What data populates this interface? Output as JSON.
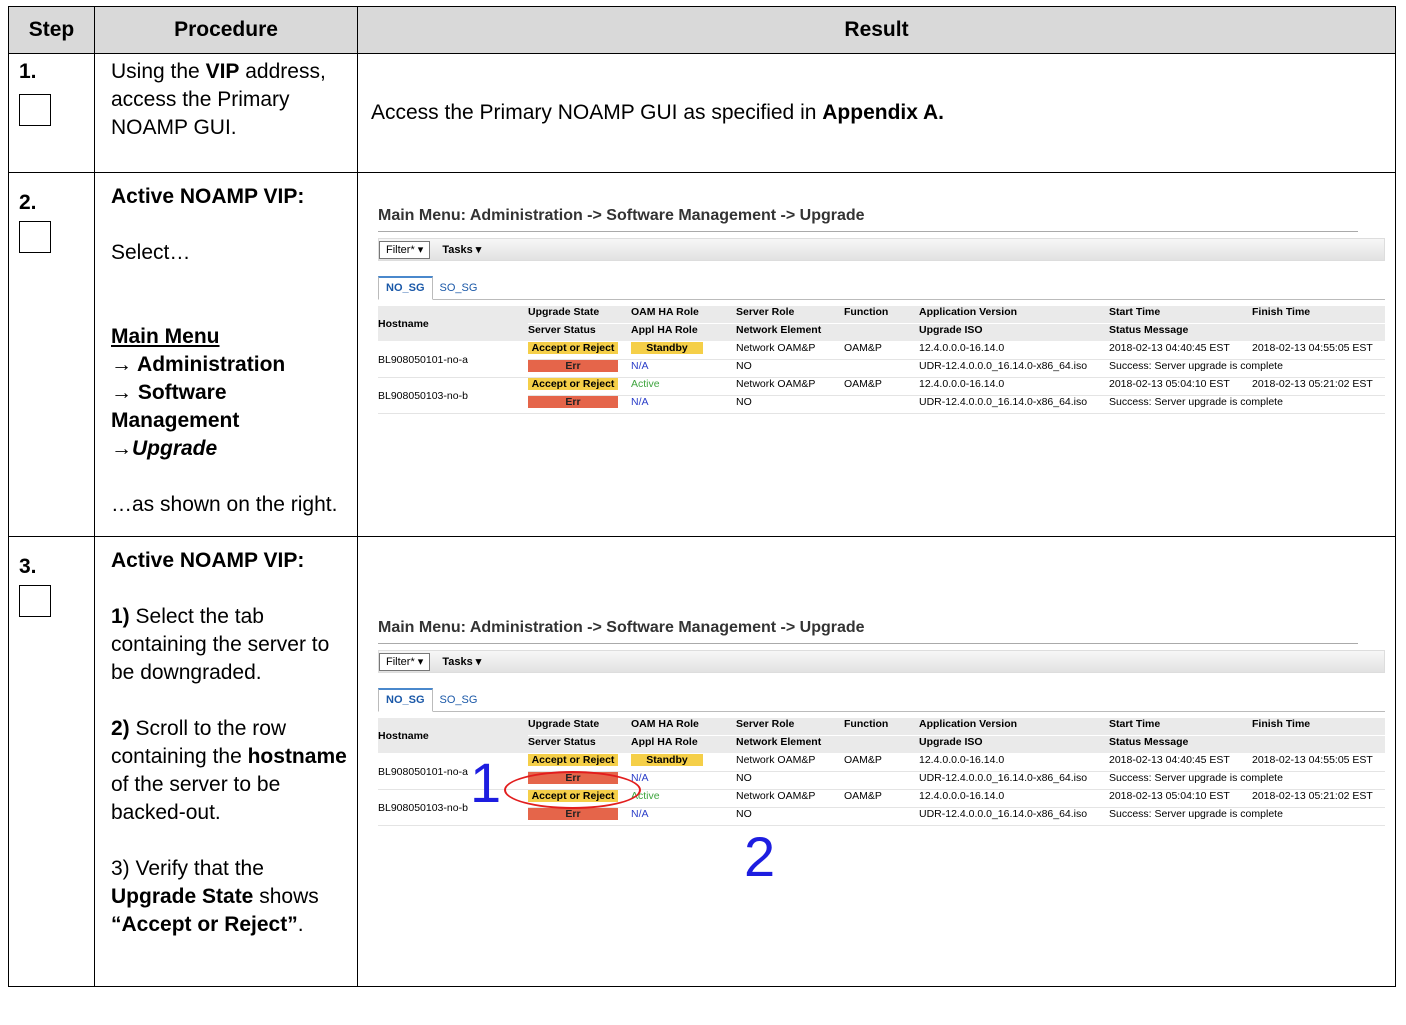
{
  "headers": {
    "step": "Step",
    "procedure": "Procedure",
    "result": "Result"
  },
  "step1": {
    "num": "1.",
    "proc_pre": "Using the ",
    "proc_bold": "VIP",
    "proc_post": " address, access the Primary NOAMP GUI.",
    "result_pre": "Access the Primary NOAMP GUI as specified in ",
    "result_bold": "Appendix A."
  },
  "step2": {
    "num": "2.",
    "heading": "Active NOAMP VIP:",
    "select": "Select…",
    "menu_main": "Main Menu",
    "menu_admin": "→ Administration",
    "menu_sw": "→ Software Management",
    "menu_upgrade": "→Upgrade",
    "shown": "…as shown on the right."
  },
  "step3": {
    "num": "3.",
    "heading": "Active NOAMP VIP:",
    "s1_num": "1)",
    "s1_text": " Select the tab containing the server to be downgraded.",
    "s2_num": "2)",
    "s2_text_a": " Scroll to the row containing the ",
    "s2_bold": "hostname",
    "s2_text_b": " of the server to be backed-out.",
    "s3_text": "3) Verify that the ",
    "s3_bold1": "Upgrade State",
    "s3_text2": " shows ",
    "s3_bold2": "“Accept or Reject”",
    "s3_end": ".",
    "annotation1": "1",
    "annotation2": "2"
  },
  "screenshot": {
    "title": "Main Menu: Administration -> Software Management -> Upgrade",
    "filter": "Filter*",
    "tasks": "Tasks",
    "tabs": [
      "NO_SG",
      "SO_SG"
    ],
    "columns1": [
      "Hostname",
      "Upgrade State",
      "OAM HA Role",
      "Server Role",
      "Function",
      "Application Version",
      "Start Time",
      "Finish Time"
    ],
    "columns2": [
      "Server Status",
      "Appl HA Role",
      "Network Element",
      "Upgrade ISO",
      "Status Message"
    ],
    "rows": [
      {
        "hostname": "BL908050101-no-a",
        "upgrade_state": "Accept or Reject",
        "oam_ha_role": "Standby",
        "server_role": "Network OAM&P",
        "function": "OAM&P",
        "app_version": "12.4.0.0.0-16.14.0",
        "start_time": "2018-02-13 04:40:45 EST",
        "finish_time": "2018-02-13 04:55:05 EST",
        "server_status": "Err",
        "appl_ha_role": "N/A",
        "network_element": "NO",
        "upgrade_iso": "UDR-12.4.0.0.0_16.14.0-x86_64.iso",
        "status_message": "Success: Server upgrade is complete"
      },
      {
        "hostname": "BL908050103-no-b",
        "upgrade_state": "Accept or Reject",
        "oam_ha_role": "Active",
        "server_role": "Network OAM&P",
        "function": "OAM&P",
        "app_version": "12.4.0.0.0-16.14.0",
        "start_time": "2018-02-13 05:04:10 EST",
        "finish_time": "2018-02-13 05:21:02 EST",
        "server_status": "Err",
        "appl_ha_role": "N/A",
        "network_element": "NO",
        "upgrade_iso": "UDR-12.4.0.0.0_16.14.0-x86_64.iso",
        "status_message": "Success: Server upgrade is complete"
      }
    ]
  },
  "colors": {
    "accept_reject": "#f5cf48",
    "err": "#e5654a",
    "na": "#2a3dc8",
    "active": "#3fa53f",
    "annotation": "#1d1de0",
    "circle": "#e21d1d"
  }
}
